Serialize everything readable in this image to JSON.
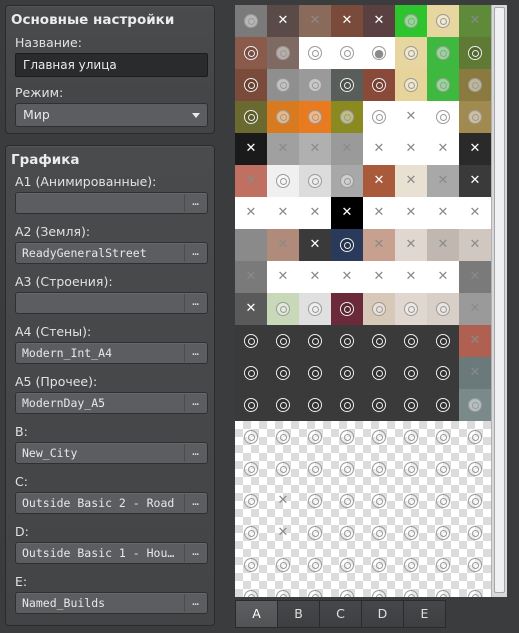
{
  "basic": {
    "title": "Основные настройки",
    "name_label": "Название:",
    "name_value": "Главная улица",
    "mode_label": "Режим:",
    "mode_value": "Мир"
  },
  "graphics": {
    "title": "Графика",
    "fields": [
      {
        "label": "A1 (Анимированные):",
        "value": ""
      },
      {
        "label": "A2 (Земля):",
        "value": "ReadyGeneralStreet"
      },
      {
        "label": "A3 (Строения):",
        "value": ""
      },
      {
        "label": "A4 (Стены):",
        "value": "Modern_Int_A4"
      },
      {
        "label": "A5 (Прочее):",
        "value": "ModernDay_A5"
      },
      {
        "label": "B:",
        "value": "New_City"
      },
      {
        "label": "C:",
        "value": "Outside Basic 2 - Road"
      },
      {
        "label": "D:",
        "value": "Outside Basic 1 - Hou…"
      },
      {
        "label": "E:",
        "value": "Named_Builds"
      }
    ],
    "browse_label": "…"
  },
  "tabs": [
    {
      "label": "A",
      "active": true
    },
    {
      "label": "B",
      "active": false
    },
    {
      "label": "C",
      "active": false
    },
    {
      "label": "D",
      "active": false
    },
    {
      "label": "E",
      "active": false
    }
  ],
  "tiles": [
    [
      "o:#7a7a7a",
      "x:#5a4a48",
      "x:#8a6a5a",
      "x:#7a4a3a",
      "x:#5a4040",
      "o:#2ec42e",
      "o:#e8d6a0",
      "x:#5f8a3a"
    ],
    [
      "o:#8a5a4a",
      "o:#7f6a63",
      "o:#ffffff",
      "o:#ffffff",
      "c:#ffffff",
      "o:#e8d6a0",
      "o:#3fb83f",
      "o:#5e7a35"
    ],
    [
      "o:#7a4a3a",
      "o:#8f8f8f",
      "o:#9a9a9a",
      "o:#5a5e5a",
      "o:#8a4a3a",
      "o:#e6d49a",
      "o:#3fb83f",
      "o:#8a7a40"
    ],
    [
      "o:#6a6a30",
      "o:#d87a20",
      "o:#e87a20",
      "o:#8a8a20",
      "o:#ffffff",
      "x:#ffffff",
      "o:#ffffff",
      "o:#a08a50"
    ],
    [
      "x:#1a1a1a",
      "x:#a0a0a0",
      "x:#b0b0b0",
      "x:#9a9a9a",
      "x:#ffffff",
      "x:#ffffff",
      "x:#ffffff",
      "x:#2a2a2a"
    ],
    [
      "x:#c07060",
      "o:#f0f0f0",
      "o:#dcdcdc",
      "o:#a8a8a8",
      "x:#a85a3a",
      "x:#e8e0d0",
      "x:#a8a8a8",
      "x:#3a3a3a"
    ],
    [
      "x:#ffffff",
      "x:#ffffff",
      "x:#ffffff",
      "x:#000000",
      "x:#ffffff",
      "x:#ffffff",
      "x:#ffffff",
      "x:#ffffff"
    ],
    [
      "x:#8a8a8a",
      "x:#b08a7a",
      "x:#3a3a3a",
      "o:#2a3a5a",
      "x:#c8a090",
      "x:#e0d8d0",
      "x:#c0b8b0",
      "x:#d0c8c0"
    ],
    [
      "x:#7a7a7a",
      "x:#ffffff",
      "x:#ffffff",
      "x:#ffffff",
      "x:#ffffff",
      "x:#ffffff",
      "x:#ffffff",
      "x:#7a7a7a"
    ],
    [
      "x:#5a5a5a",
      "o:#c8d8b8",
      "o:#e0e0e0",
      "o:#6a2a3a",
      "o:#d8c8b8",
      "o:#e0d8d0",
      "o:#d8d0c8",
      "x:#9a9a9a"
    ],
    [
      "o:#3a3a3a",
      "o:#3a3a3a",
      "o:#3a3a3a",
      "o:#3a3a3a",
      "o:#3a3a3a",
      "o:#3a3a3a",
      "o:#3a3a3a",
      "x:#b06050"
    ],
    [
      "o:#3a3a3a",
      "o:#3a3a3a",
      "o:#3a3a3a",
      "o:#3a3a3a",
      "o:#3a3a3a",
      "o:#3a3a3a",
      "o:#3a3a3a",
      "x:#6a7a7a"
    ],
    [
      "o:#3a3a3a",
      "o:#3a3a3a",
      "o:#3a3a3a",
      "o:#3a3a3a",
      "o:#3a3a3a",
      "o:#3a3a3a",
      "o:#3a3a3a",
      "o:#7a8a8a"
    ],
    [
      "o:",
      "o:",
      "o:",
      "o:",
      "o:",
      "o:",
      "o:",
      "o:"
    ],
    [
      "o:",
      "o:",
      "o:",
      "o:",
      "o:",
      "o:",
      "o:",
      "o:"
    ],
    [
      "o:",
      "x:",
      "o:",
      "o:",
      "o:",
      "o:",
      "o:",
      "o:"
    ],
    [
      "o:",
      "x:",
      "o:",
      "o:",
      "o:",
      "o:",
      "o:",
      "o:"
    ],
    [
      "o:",
      "o:",
      "o:",
      "o:",
      "o:",
      "o:",
      "o:",
      "o:"
    ],
    [
      "o:",
      "o:",
      "o:",
      "o:",
      "o:",
      "o:",
      "o:",
      "o:"
    ]
  ]
}
